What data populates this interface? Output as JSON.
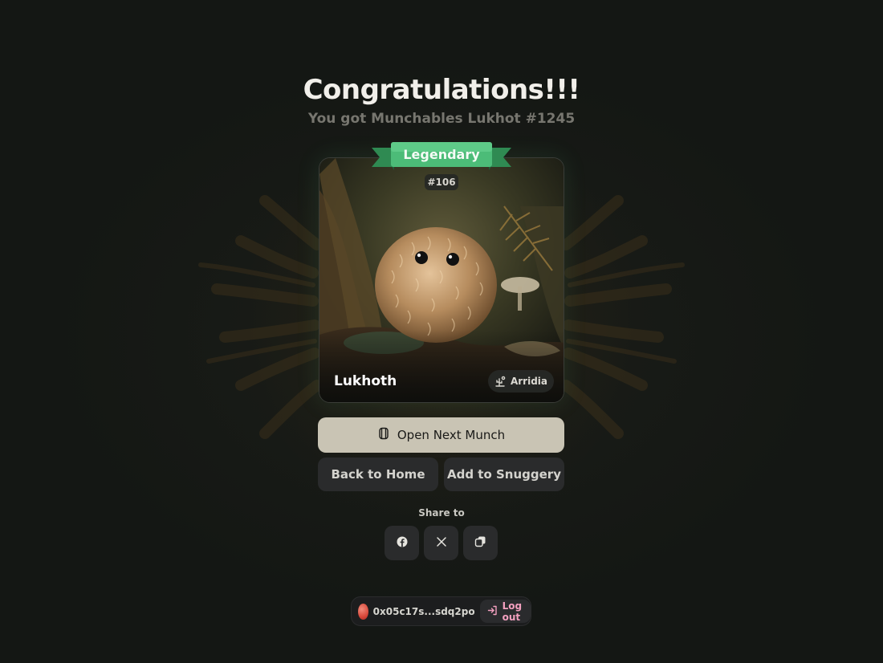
{
  "header": {
    "title": "Congratulations!!!",
    "subtitle": "You got Munchables Lukhot #1245"
  },
  "card": {
    "rarity": "Legendary",
    "token_id": "#106",
    "name": "Lukhoth",
    "realm": "Arridia",
    "realm_icon": "cactus-icon",
    "art": "fluffy-creature-in-forest"
  },
  "actions": {
    "primary_label": "Open Next Munch",
    "primary_icon": "capsule-icon",
    "back_label": "Back to Home",
    "snuggery_label": "Add to Snuggery"
  },
  "share": {
    "label": "Share to",
    "targets": [
      "facebook-icon",
      "x-icon",
      "copy-icon"
    ]
  },
  "wallet": {
    "address": "0x05c17s...sdq2po",
    "logout_label": "Log out"
  },
  "colors": {
    "background": "#141714",
    "rarity_green": "#3fae6a",
    "primary_button": "#c9c4b4",
    "dark_button": "#2a2b2c",
    "logout_pink": "#f3a0bf"
  }
}
